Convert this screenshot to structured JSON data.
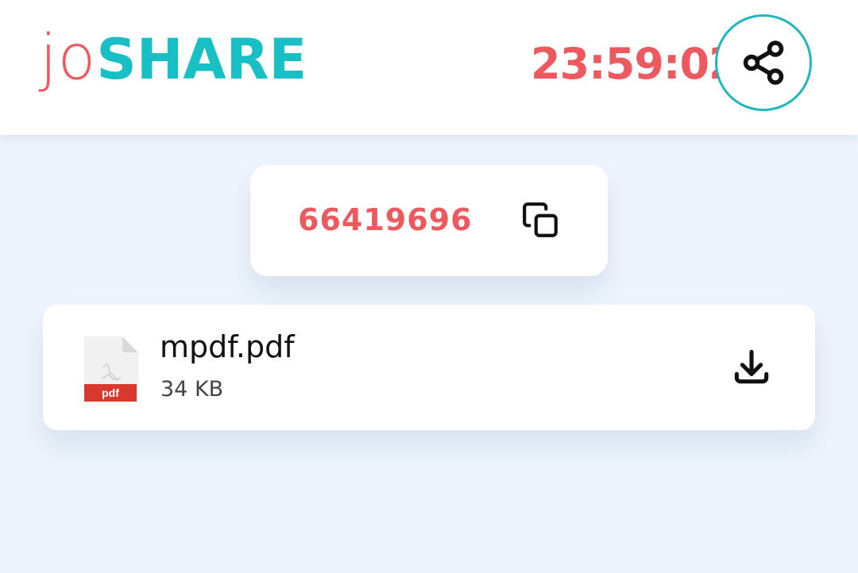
{
  "header": {
    "logo": {
      "prefix": "jo",
      "suffix": "SHARE"
    },
    "timer": "23:59:02",
    "share_icon": "share-icon"
  },
  "code_card": {
    "code": "66419696",
    "copy_icon": "copy-icon"
  },
  "file": {
    "name": "mpdf.pdf",
    "size": "34 KB",
    "type_label": "pdf",
    "file_icon": "pdf-file-icon",
    "download_icon": "download-icon"
  },
  "colors": {
    "accent_red": "#ec5a5f",
    "accent_teal": "#18bfc4",
    "background": "#edf4fd"
  }
}
